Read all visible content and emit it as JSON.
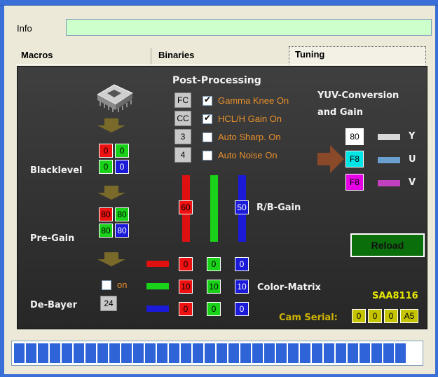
{
  "info": {
    "label": "Info",
    "value": ""
  },
  "tabs": [
    {
      "label": "Macros"
    },
    {
      "label": "Binaries"
    },
    {
      "label": "Tuning"
    }
  ],
  "panel": {
    "post_processing": "Post-Processing",
    "pp_buttons": [
      "FC",
      "CC",
      "3",
      "4"
    ],
    "pp_options": [
      {
        "label": "Gamma Knee On",
        "checked": true
      },
      {
        "label": "HCL/H Gain On",
        "checked": true
      },
      {
        "label": "Auto Sharp. On",
        "checked": false
      },
      {
        "label": "Auto Noise On",
        "checked": false
      }
    ],
    "yuv_title_1": "YUV-Conversion",
    "yuv_title_2": "and Gain",
    "yuv_values": [
      "80",
      "F8",
      "F8"
    ],
    "yuv_labels": [
      "Y",
      "U",
      "V"
    ],
    "blacklevel_label": "Blacklevel",
    "blacklevel": [
      "0",
      "0",
      "0",
      "0"
    ],
    "pregain_label": "Pre-Gain",
    "pregain": [
      "80",
      "80",
      "80",
      "80"
    ],
    "debayer_label": "De-Bayer",
    "debayer_on": "on",
    "debayer_value": "24",
    "rb_gain_label": "R/B-Gain",
    "rb_gain": [
      "60",
      "50"
    ],
    "color_matrix_label": "Color-Matrix",
    "color_matrix": [
      [
        "0",
        "0",
        "0"
      ],
      [
        "10",
        "10",
        "10"
      ],
      [
        "0",
        "0",
        "0"
      ]
    ],
    "reload_label": "Reload",
    "chip": "SAA8116",
    "cam_serial_label": "Cam Serial:",
    "cam_serial": [
      "0",
      "0",
      "0",
      "A5"
    ]
  },
  "colors": {
    "red": "#ee1111",
    "green": "#19d219",
    "blue": "#1a1ad8",
    "cyan": "#00e5e5",
    "magenta": "#e600e6",
    "accent_orange": "#e8902c",
    "serial_yellow": "#e8e800"
  },
  "progress": {
    "fraction": 1.0
  }
}
